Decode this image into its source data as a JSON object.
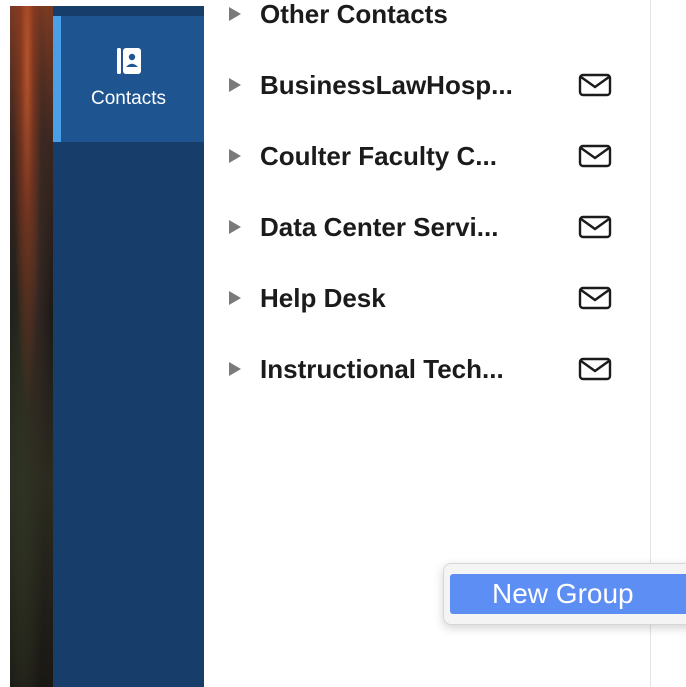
{
  "nav": {
    "contacts_label": "Contacts"
  },
  "groups": [
    {
      "name": "Other Contacts",
      "has_mail": false
    },
    {
      "name": "BusinessLawHosp...",
      "has_mail": true
    },
    {
      "name": "Coulter Faculty C...",
      "has_mail": true
    },
    {
      "name": "Data Center Servi...",
      "has_mail": true
    },
    {
      "name": "Help Desk",
      "has_mail": true
    },
    {
      "name": "Instructional Tech...",
      "has_mail": true
    }
  ],
  "context_menu": {
    "new_group_label": "New Group"
  },
  "colors": {
    "nav_background": "#173d6b",
    "nav_selected": "#1e5590",
    "nav_selector": "#4aa0e8",
    "menu_highlight": "#5d8ef3"
  }
}
